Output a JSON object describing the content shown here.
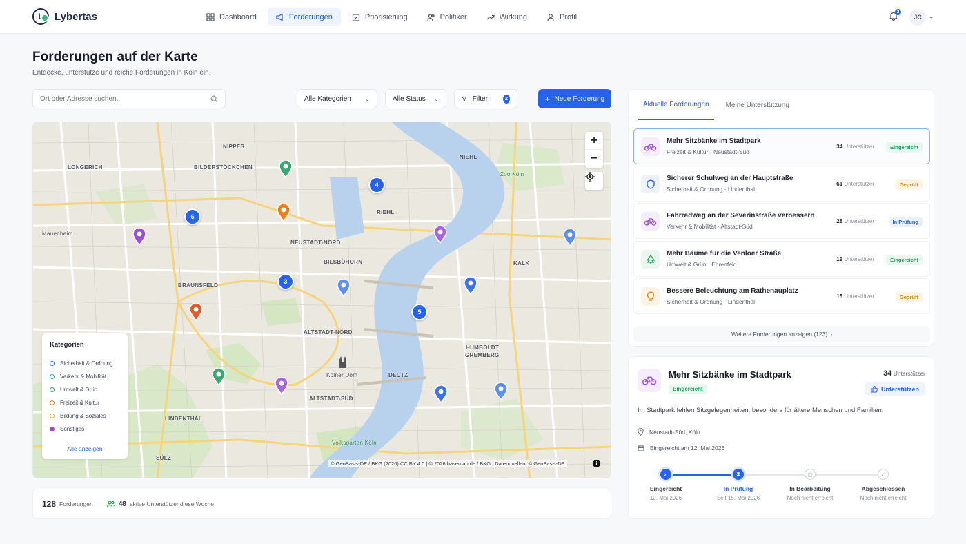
{
  "app": {
    "name": "Lybertas"
  },
  "nav": [
    {
      "label": "Dashboard",
      "icon": "grid-icon",
      "active": false
    },
    {
      "label": "Forderungen",
      "icon": "megaphone-icon",
      "active": true
    },
    {
      "label": "Priorisierung",
      "icon": "ballot-icon",
      "active": false
    },
    {
      "label": "Politiker",
      "icon": "people-icon",
      "active": false
    },
    {
      "label": "Wirkung",
      "icon": "trend-icon",
      "active": false
    },
    {
      "label": "Profil",
      "icon": "user-icon",
      "active": false
    }
  ],
  "user": {
    "initials": "JC",
    "notifications": "2"
  },
  "page": {
    "title": "Forderungen auf der Karte",
    "subtitle": "Entdecke, unterstütze und reiche Forderungen in Köln ein."
  },
  "toolbar": {
    "search_placeholder": "Ort oder Adresse suchen...",
    "category_select": "Alle Kategorien",
    "status_select": "Alle Status",
    "filter_label": "Filter",
    "filter_count": "2",
    "new_button": "Neue Forderung"
  },
  "map": {
    "labels": {
      "nippes": "NIPPES",
      "longerich": "LONGERICH",
      "bilderstoeckchen": "BILDERSTÖCKCHEN",
      "niehl": "NIEHL",
      "zoo": "Zoo Köln",
      "riehl": "RIEHL",
      "mauenheim": "Mauenheim",
      "neustadt_nord": "NEUSTADT-NORD",
      "bilsbuhorn": "BILSBÜHORN",
      "kalk": "KALK",
      "braunsfeld": "BRAUNSFELD",
      "altstadt_nord": "ALTSTADT-NORD",
      "humboldt": "HUMBOLDT",
      "gremberg": "GREMBERG",
      "koelner_dom": "Kölner Dom",
      "deutz": "DEUTZ",
      "altstadt_sued": "ALTSTADT-SÜD",
      "lindenthal": "LINDENTHAL",
      "volksgarten": "Volksgarten Köln",
      "suelz": "SÜLZ"
    },
    "clusters": [
      "6",
      "4",
      "3",
      "5"
    ],
    "attribution": "© GeoBasis-DE / BKG (2026) CC BY 4.0 | © 2026 basemap.de / BKG | Datenquellen: © GeoBasis-DE",
    "zoom_in": "+",
    "zoom_out": "−",
    "info": "i"
  },
  "legend": {
    "title": "Kategorien",
    "items": [
      {
        "label": "Sicherheit & Ordnung",
        "color": "#2563eb"
      },
      {
        "label": "Verkehr & Mobilität",
        "color": "#17a2b8"
      },
      {
        "label": "Umwelt & Grün",
        "color": "#22a05a"
      },
      {
        "label": "Freizeit & Kultur",
        "color": "#ef7d1a"
      },
      {
        "label": "Bildung & Soziales",
        "color": "#f5a623"
      },
      {
        "label": "Sonstiges",
        "color": "#9b4dd6"
      }
    ],
    "link": "Alle anzeigen"
  },
  "stats": {
    "total": "128",
    "total_label": "Forderungen",
    "active": "48",
    "active_label": "aktive Unterstützer diese Woche"
  },
  "panel": {
    "tabs": [
      "Aktuelle Forderungen",
      "Meine Unterstützung"
    ],
    "requests": [
      {
        "title": "Mehr Sitzbänke im Stadtpark",
        "category": "Freizeit & Kultur",
        "area": "Neustadt-Süd",
        "supporters": "34",
        "sup_label": "Unterstützer",
        "status": "Eingereicht"
      },
      {
        "title": "Sicherer Schulweg an der Hauptstraße",
        "category": "Sicherheit & Ordnung",
        "area": "Lindenthal",
        "supporters": "61",
        "sup_label": "Unterstützer",
        "status": "Geprüft"
      },
      {
        "title": "Fahrradweg an der Severinstraße verbessern",
        "category": "Verkehr & Mobilität",
        "area": "Altstadt-Süd",
        "supporters": "28",
        "sup_label": "Unterstützer",
        "status": "In Prüfung"
      },
      {
        "title": "Mehr Bäume für die Venloer Straße",
        "category": "Umwelt & Grün",
        "area": "Ehrenfeld",
        "supporters": "19",
        "sup_label": "Unterstützer",
        "status": "Eingereicht"
      },
      {
        "title": "Bessere Beleuchtung am Rathenauplatz",
        "category": "Sicherheit & Ordnung",
        "area": "Lindenthal",
        "supporters": "15",
        "sup_label": "Unterstützer",
        "status": "Geprüft"
      }
    ],
    "more": "Weitere Forderungen anzeigen (123)"
  },
  "detail": {
    "title": "Mehr Sitzbänke im Stadtpark",
    "status": "Eingereicht",
    "supporters": "34",
    "sup_label": "Unterstützer",
    "support_button": "Unterstützen",
    "description": "Im Stadtpark fehlen Sitzgelegenheiten, besonders für ältere Menschen und Familien.",
    "location": "Neustadt-Süd, Köln",
    "submitted": "Eingereicht am 12. Mai 2026",
    "steps": [
      {
        "name": "Eingereicht",
        "date": "12. Mai 2026",
        "state": "done"
      },
      {
        "name": "In Prüfung",
        "date": "Seit 15. Mai 2026",
        "state": "current"
      },
      {
        "name": "In Bearbeitung",
        "date": "Noch nicht erreicht",
        "state": "todo"
      },
      {
        "name": "Abgeschlossen",
        "date": "Noch nicht erreicht",
        "state": "todo"
      }
    ]
  }
}
